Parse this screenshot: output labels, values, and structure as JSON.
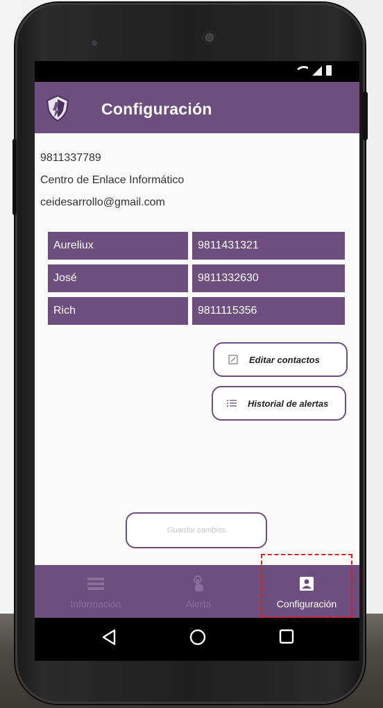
{
  "app": {
    "title": "Configuración"
  },
  "profile": {
    "phone": "9811337789",
    "organization": "Centro de Enlace Informático",
    "email": "ceidesarrollo@gmail.com"
  },
  "contacts": [
    {
      "name": "Aureliux",
      "phone": "9811431321"
    },
    {
      "name": "José",
      "phone": "9811332630"
    },
    {
      "name": "Rich",
      "phone": "9811115356"
    }
  ],
  "buttons": {
    "edit_contacts": "Editar contactos",
    "alert_history": "Historial de alertas",
    "save_changes": "Guardar cambios"
  },
  "bottom_nav": {
    "info": "Información",
    "alert": "Alerta",
    "config": "Configuración"
  },
  "colors": {
    "primary": "#6d4e7e",
    "highlight": "#e02020"
  }
}
